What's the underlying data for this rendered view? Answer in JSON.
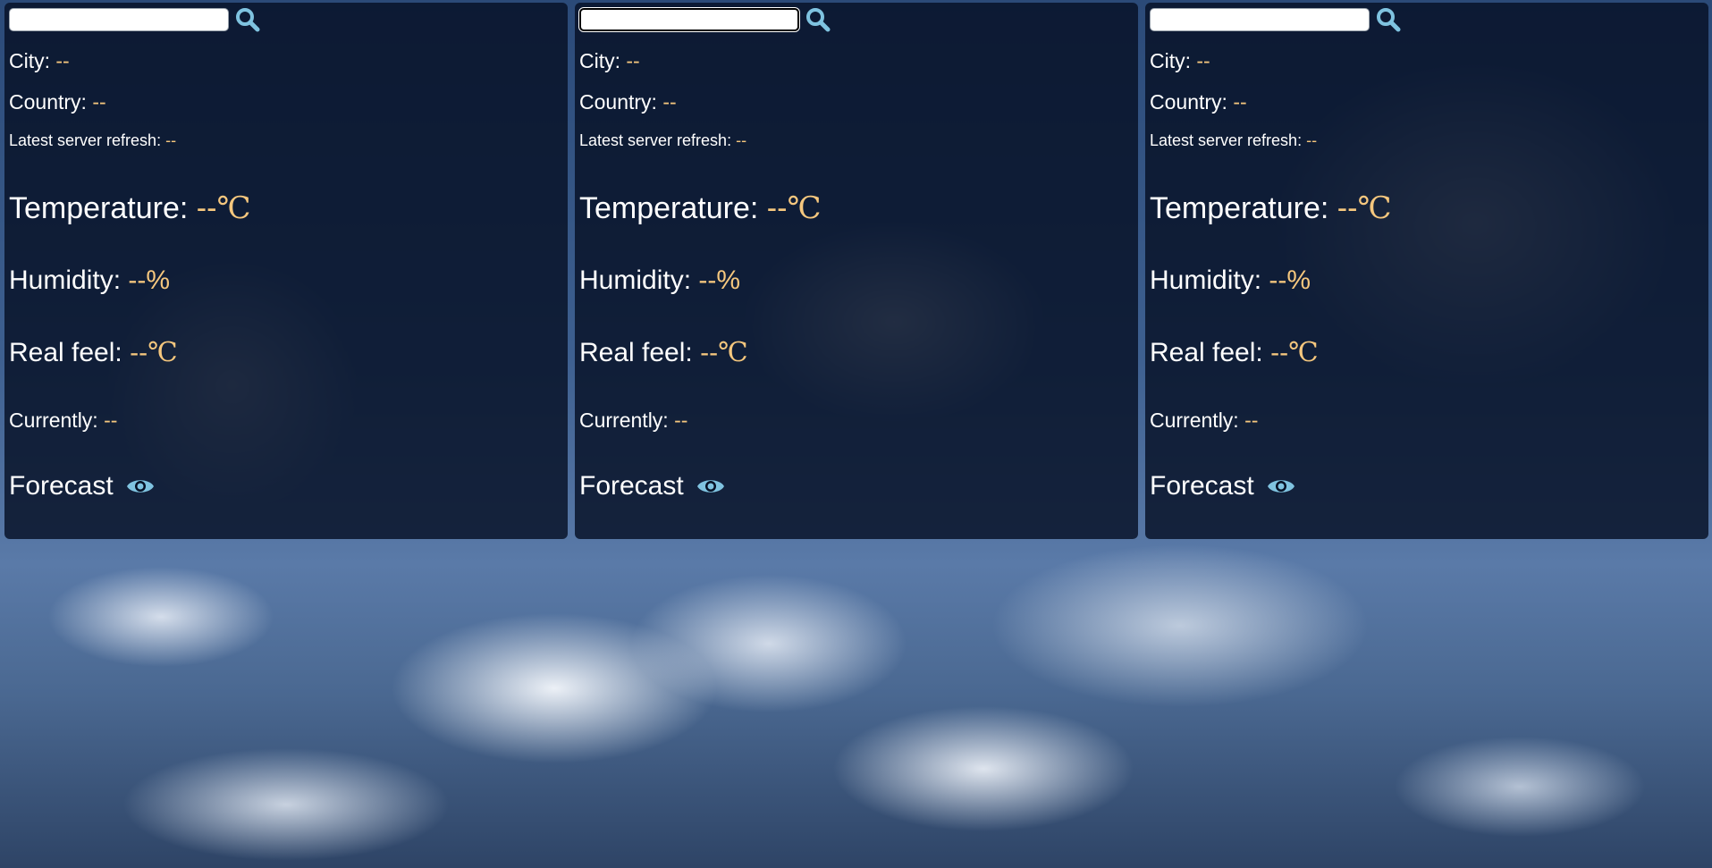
{
  "accent_color": "#f5c77e",
  "icon_color": "#7fc3e0",
  "panels": [
    {
      "search": {
        "value": "",
        "placeholder": ""
      },
      "city_label": "City:",
      "city_value": "--",
      "country_label": "Country:",
      "country_value": "--",
      "refresh_label": "Latest server refresh:",
      "refresh_value": "--",
      "temperature_label": "Temperature:",
      "temperature_value": "--",
      "temperature_unit": "℃",
      "humidity_label": "Humidity:",
      "humidity_value": "--%",
      "real_feel_label": "Real feel:",
      "real_feel_value": "--",
      "real_feel_unit": "℃",
      "currently_label": "Currently:",
      "currently_value": "--",
      "forecast_label": "Forecast",
      "search_icon": "search-icon",
      "forecast_icon": "eye-icon"
    },
    {
      "search": {
        "value": "",
        "placeholder": ""
      },
      "city_label": "City:",
      "city_value": "--",
      "country_label": "Country:",
      "country_value": "--",
      "refresh_label": "Latest server refresh:",
      "refresh_value": "--",
      "temperature_label": "Temperature:",
      "temperature_value": "--",
      "temperature_unit": "℃",
      "humidity_label": "Humidity:",
      "humidity_value": "--%",
      "real_feel_label": "Real feel:",
      "real_feel_value": "--",
      "real_feel_unit": "℃",
      "currently_label": "Currently:",
      "currently_value": "--",
      "forecast_label": "Forecast",
      "search_icon": "search-icon",
      "forecast_icon": "eye-icon"
    },
    {
      "search": {
        "value": "",
        "placeholder": ""
      },
      "city_label": "City:",
      "city_value": "--",
      "country_label": "Country:",
      "country_value": "--",
      "refresh_label": "Latest server refresh:",
      "refresh_value": "--",
      "temperature_label": "Temperature:",
      "temperature_value": "--",
      "temperature_unit": "℃",
      "humidity_label": "Humidity:",
      "humidity_value": "--%",
      "real_feel_label": "Real feel:",
      "real_feel_value": "--",
      "real_feel_unit": "℃",
      "currently_label": "Currently:",
      "currently_value": "--",
      "forecast_label": "Forecast",
      "search_icon": "search-icon",
      "forecast_icon": "eye-icon"
    }
  ]
}
